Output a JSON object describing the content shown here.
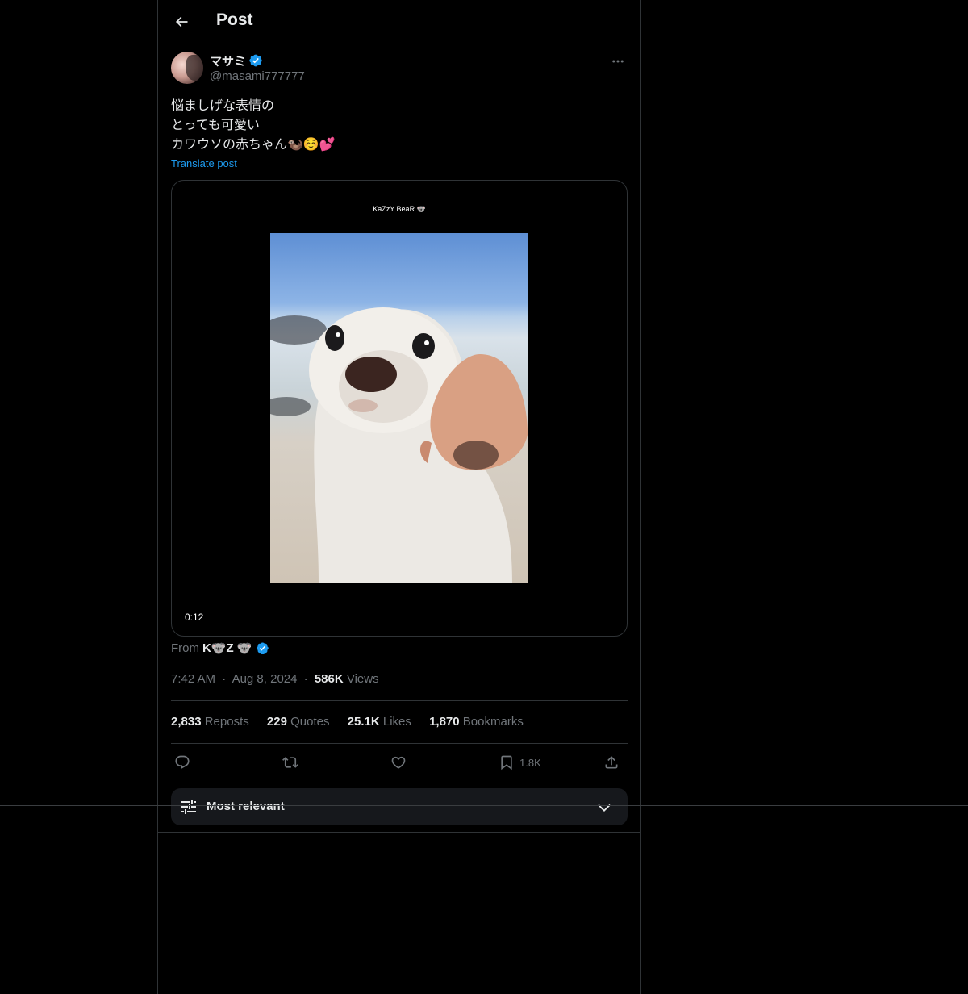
{
  "header": {
    "title": "Post",
    "back_icon": "arrow-left-icon"
  },
  "author": {
    "display_name": "マサミ",
    "handle": "@masami777777",
    "verified_color": "#1d9bf0"
  },
  "post": {
    "lines": [
      "悩ましげな表情の",
      "とっても可愛い",
      "カワウソの赤ちゃん🦦☺️💕"
    ],
    "translate_label": "Translate post"
  },
  "media": {
    "watermark": "KaZzY BeaR 🐨",
    "duration": "0:12"
  },
  "source": {
    "prefix": "From",
    "name": "K🐨Z 🐨"
  },
  "meta": {
    "time": "7:42 AM",
    "sep": "·",
    "date": "Aug 8, 2024",
    "views_count": "586K",
    "views_label": "Views"
  },
  "stats": [
    {
      "count": "2,833",
      "label": "Reposts"
    },
    {
      "count": "229",
      "label": "Quotes"
    },
    {
      "count": "25.1K",
      "label": "Likes"
    },
    {
      "count": "1,870",
      "label": "Bookmarks"
    }
  ],
  "actions": {
    "bookmark_count": "1.8K"
  },
  "sort": {
    "label": "Most relevant"
  }
}
